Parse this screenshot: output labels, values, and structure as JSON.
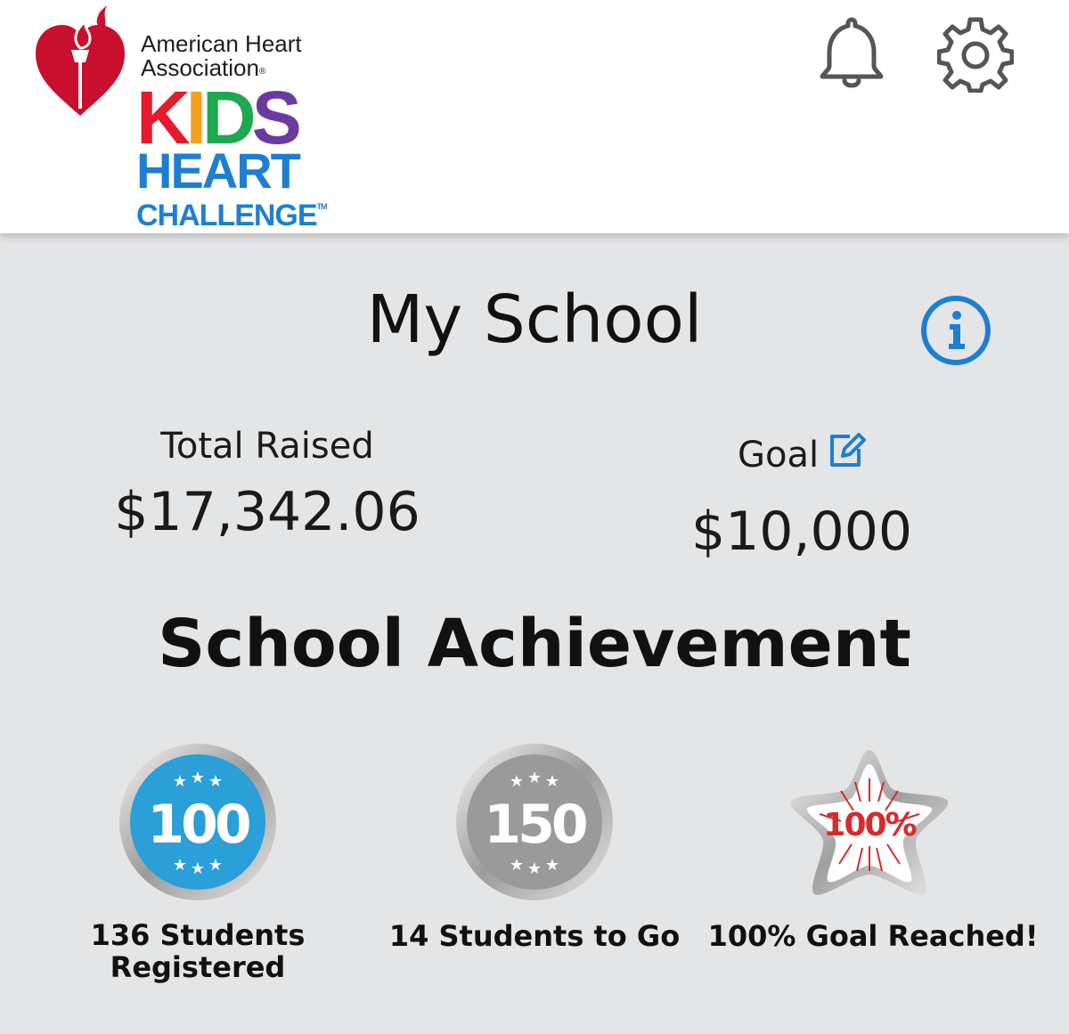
{
  "header": {
    "org_line1": "American Heart",
    "org_line2": "Association",
    "reg_mark": "®",
    "brand_kids": [
      "K",
      "I",
      "D",
      "S"
    ],
    "brand_heart": "HEART",
    "brand_challenge": "CHALLENGE",
    "tm_mark": "TM",
    "icons": [
      "bell-icon",
      "gear-icon"
    ]
  },
  "main": {
    "title": "My School",
    "total_raised_label": "Total Raised",
    "total_raised_value": "$17,342.06",
    "goal_label": "Goal",
    "goal_value": "$10,000",
    "achievement_title": "School Achievement",
    "badges": [
      {
        "number": "100",
        "caption_line1": "136 Students",
        "caption_line2": "Registered",
        "color": "#2a9fd8"
      },
      {
        "number": "150",
        "caption_line1": "14 Students to Go",
        "caption_line2": "",
        "color": "#9a9a9a"
      },
      {
        "number": "100%",
        "caption_line1": "100% Goal Reached!",
        "caption_line2": "",
        "color": "#d62b2b"
      }
    ]
  },
  "colors": {
    "accent_blue": "#1e7fd2",
    "background": "#e4e5e6",
    "aha_red": "#c8102e"
  }
}
